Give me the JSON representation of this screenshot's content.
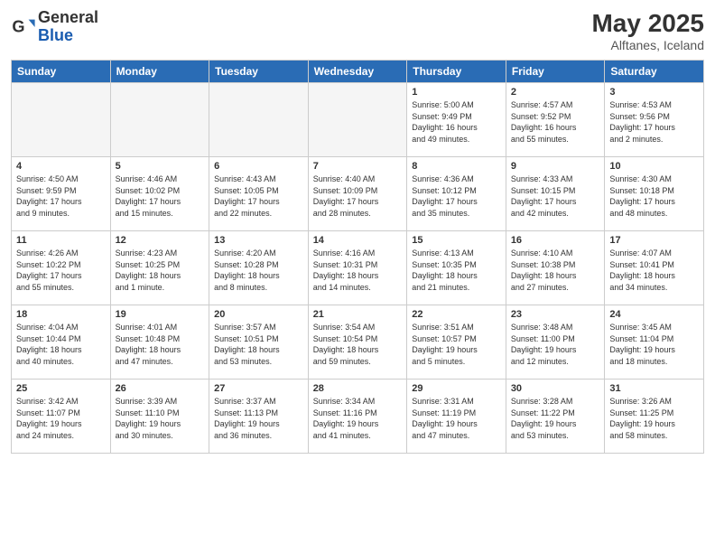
{
  "logo": {
    "general": "General",
    "blue": "Blue"
  },
  "title": "May 2025",
  "location": "Alftanes, Iceland",
  "headers": [
    "Sunday",
    "Monday",
    "Tuesday",
    "Wednesday",
    "Thursday",
    "Friday",
    "Saturday"
  ],
  "weeks": [
    [
      {
        "day": "",
        "info": "",
        "empty": true
      },
      {
        "day": "",
        "info": "",
        "empty": true
      },
      {
        "day": "",
        "info": "",
        "empty": true
      },
      {
        "day": "",
        "info": "",
        "empty": true
      },
      {
        "day": "1",
        "info": "Sunrise: 5:00 AM\nSunset: 9:49 PM\nDaylight: 16 hours\nand 49 minutes."
      },
      {
        "day": "2",
        "info": "Sunrise: 4:57 AM\nSunset: 9:52 PM\nDaylight: 16 hours\nand 55 minutes."
      },
      {
        "day": "3",
        "info": "Sunrise: 4:53 AM\nSunset: 9:56 PM\nDaylight: 17 hours\nand 2 minutes."
      }
    ],
    [
      {
        "day": "4",
        "info": "Sunrise: 4:50 AM\nSunset: 9:59 PM\nDaylight: 17 hours\nand 9 minutes."
      },
      {
        "day": "5",
        "info": "Sunrise: 4:46 AM\nSunset: 10:02 PM\nDaylight: 17 hours\nand 15 minutes."
      },
      {
        "day": "6",
        "info": "Sunrise: 4:43 AM\nSunset: 10:05 PM\nDaylight: 17 hours\nand 22 minutes."
      },
      {
        "day": "7",
        "info": "Sunrise: 4:40 AM\nSunset: 10:09 PM\nDaylight: 17 hours\nand 28 minutes."
      },
      {
        "day": "8",
        "info": "Sunrise: 4:36 AM\nSunset: 10:12 PM\nDaylight: 17 hours\nand 35 minutes."
      },
      {
        "day": "9",
        "info": "Sunrise: 4:33 AM\nSunset: 10:15 PM\nDaylight: 17 hours\nand 42 minutes."
      },
      {
        "day": "10",
        "info": "Sunrise: 4:30 AM\nSunset: 10:18 PM\nDaylight: 17 hours\nand 48 minutes."
      }
    ],
    [
      {
        "day": "11",
        "info": "Sunrise: 4:26 AM\nSunset: 10:22 PM\nDaylight: 17 hours\nand 55 minutes."
      },
      {
        "day": "12",
        "info": "Sunrise: 4:23 AM\nSunset: 10:25 PM\nDaylight: 18 hours\nand 1 minute."
      },
      {
        "day": "13",
        "info": "Sunrise: 4:20 AM\nSunset: 10:28 PM\nDaylight: 18 hours\nand 8 minutes."
      },
      {
        "day": "14",
        "info": "Sunrise: 4:16 AM\nSunset: 10:31 PM\nDaylight: 18 hours\nand 14 minutes."
      },
      {
        "day": "15",
        "info": "Sunrise: 4:13 AM\nSunset: 10:35 PM\nDaylight: 18 hours\nand 21 minutes."
      },
      {
        "day": "16",
        "info": "Sunrise: 4:10 AM\nSunset: 10:38 PM\nDaylight: 18 hours\nand 27 minutes."
      },
      {
        "day": "17",
        "info": "Sunrise: 4:07 AM\nSunset: 10:41 PM\nDaylight: 18 hours\nand 34 minutes."
      }
    ],
    [
      {
        "day": "18",
        "info": "Sunrise: 4:04 AM\nSunset: 10:44 PM\nDaylight: 18 hours\nand 40 minutes."
      },
      {
        "day": "19",
        "info": "Sunrise: 4:01 AM\nSunset: 10:48 PM\nDaylight: 18 hours\nand 47 minutes."
      },
      {
        "day": "20",
        "info": "Sunrise: 3:57 AM\nSunset: 10:51 PM\nDaylight: 18 hours\nand 53 minutes."
      },
      {
        "day": "21",
        "info": "Sunrise: 3:54 AM\nSunset: 10:54 PM\nDaylight: 18 hours\nand 59 minutes."
      },
      {
        "day": "22",
        "info": "Sunrise: 3:51 AM\nSunset: 10:57 PM\nDaylight: 19 hours\nand 5 minutes."
      },
      {
        "day": "23",
        "info": "Sunrise: 3:48 AM\nSunset: 11:00 PM\nDaylight: 19 hours\nand 12 minutes."
      },
      {
        "day": "24",
        "info": "Sunrise: 3:45 AM\nSunset: 11:04 PM\nDaylight: 19 hours\nand 18 minutes."
      }
    ],
    [
      {
        "day": "25",
        "info": "Sunrise: 3:42 AM\nSunset: 11:07 PM\nDaylight: 19 hours\nand 24 minutes."
      },
      {
        "day": "26",
        "info": "Sunrise: 3:39 AM\nSunset: 11:10 PM\nDaylight: 19 hours\nand 30 minutes."
      },
      {
        "day": "27",
        "info": "Sunrise: 3:37 AM\nSunset: 11:13 PM\nDaylight: 19 hours\nand 36 minutes."
      },
      {
        "day": "28",
        "info": "Sunrise: 3:34 AM\nSunset: 11:16 PM\nDaylight: 19 hours\nand 41 minutes."
      },
      {
        "day": "29",
        "info": "Sunrise: 3:31 AM\nSunset: 11:19 PM\nDaylight: 19 hours\nand 47 minutes."
      },
      {
        "day": "30",
        "info": "Sunrise: 3:28 AM\nSunset: 11:22 PM\nDaylight: 19 hours\nand 53 minutes."
      },
      {
        "day": "31",
        "info": "Sunrise: 3:26 AM\nSunset: 11:25 PM\nDaylight: 19 hours\nand 58 minutes."
      }
    ]
  ]
}
